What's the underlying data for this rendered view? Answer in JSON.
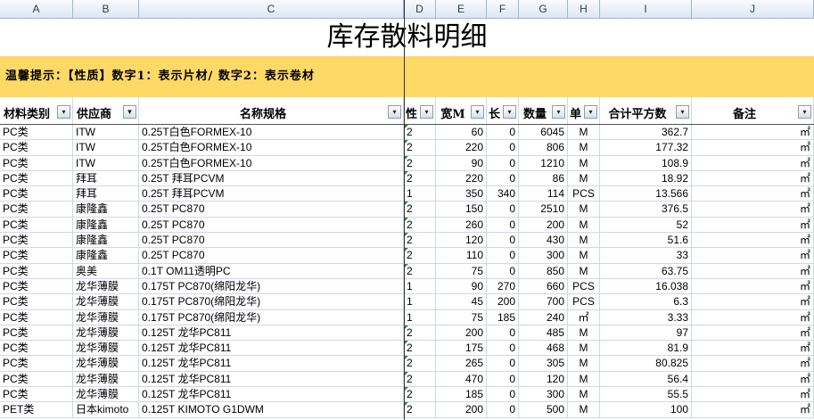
{
  "columns": [
    "A",
    "B",
    "C",
    "D",
    "E",
    "F",
    "G",
    "H",
    "I",
    "J"
  ],
  "title": "库存散料明细",
  "tip": "温馨提示：【性质】数字1：表示片材/ 数字2：表示卷材",
  "headers": [
    "材料类别",
    "供应商",
    "名称规格",
    "性",
    "宽M",
    "长",
    "数量",
    "单",
    "合计平方数",
    "备注"
  ],
  "rows": [
    [
      "PC类",
      "ITW",
      "0.25T白色FORMEX-10",
      "2",
      "60",
      "0",
      "6045",
      "M",
      "362.7",
      "㎡"
    ],
    [
      "PC类",
      "ITW",
      "0.25T白色FORMEX-10",
      "2",
      "220",
      "0",
      "806",
      "M",
      "177.32",
      "㎡"
    ],
    [
      "PC类",
      "ITW",
      "0.25T白色FORMEX-10",
      "2",
      "90",
      "0",
      "1210",
      "M",
      "108.9",
      "㎡"
    ],
    [
      "PC类",
      "拜耳",
      "0.25T 拜耳PCVM",
      "2",
      "220",
      "0",
      "86",
      "M",
      "18.92",
      "㎡"
    ],
    [
      "PC类",
      "拜耳",
      "0.25T 拜耳PCVM",
      "1",
      "350",
      "340",
      "114",
      "PCS",
      "13.566",
      "㎡"
    ],
    [
      "PC类",
      "康隆鑫",
      "0.25T PC870",
      "2",
      "150",
      "0",
      "2510",
      "M",
      "376.5",
      "㎡"
    ],
    [
      "PC类",
      "康隆鑫",
      "0.25T PC870",
      "2",
      "260",
      "0",
      "200",
      "M",
      "52",
      "㎡"
    ],
    [
      "PC类",
      "康隆鑫",
      "0.25T PC870",
      "2",
      "120",
      "0",
      "430",
      "M",
      "51.6",
      "㎡"
    ],
    [
      "PC类",
      "康隆鑫",
      "0.25T PC870",
      "2",
      "110",
      "0",
      "300",
      "M",
      "33",
      "㎡"
    ],
    [
      "PC类",
      "奥美",
      "0.1T OM11透明PC",
      "2",
      "75",
      "0",
      "850",
      "M",
      "63.75",
      "㎡"
    ],
    [
      "PC类",
      "龙华薄膜",
      "0.175T PC870(绵阳龙华)",
      "1",
      "90",
      "270",
      "660",
      "PCS",
      "16.038",
      "㎡"
    ],
    [
      "PC类",
      "龙华薄膜",
      "0.175T PC870(绵阳龙华)",
      "1",
      "45",
      "200",
      "700",
      "PCS",
      "6.3",
      "㎡"
    ],
    [
      "PC类",
      "龙华薄膜",
      "0.175T PC870(绵阳龙华)",
      "1",
      "75",
      "185",
      "240",
      "㎡",
      "3.33",
      "㎡"
    ],
    [
      "PC类",
      "龙华薄膜",
      "0.125T 龙华PC811",
      "2",
      "200",
      "0",
      "485",
      "M",
      "97",
      "㎡"
    ],
    [
      "PC类",
      "龙华薄膜",
      "0.125T 龙华PC811",
      "2",
      "175",
      "0",
      "468",
      "M",
      "81.9",
      "㎡"
    ],
    [
      "PC类",
      "龙华薄膜",
      "0.125T 龙华PC811",
      "2",
      "265",
      "0",
      "305",
      "M",
      "80.825",
      "㎡"
    ],
    [
      "PC类",
      "龙华薄膜",
      "0.125T 龙华PC811",
      "2",
      "470",
      "0",
      "120",
      "M",
      "56.4",
      "㎡"
    ],
    [
      "PC类",
      "龙华薄膜",
      "0.125T 龙华PC811",
      "2",
      "185",
      "0",
      "300",
      "M",
      "55.5",
      "㎡"
    ],
    [
      "PET类",
      "日本kimoto",
      "0.125T KIMOTO G1DWM",
      "2",
      "200",
      "0",
      "500",
      "M",
      "100",
      "㎡"
    ]
  ]
}
